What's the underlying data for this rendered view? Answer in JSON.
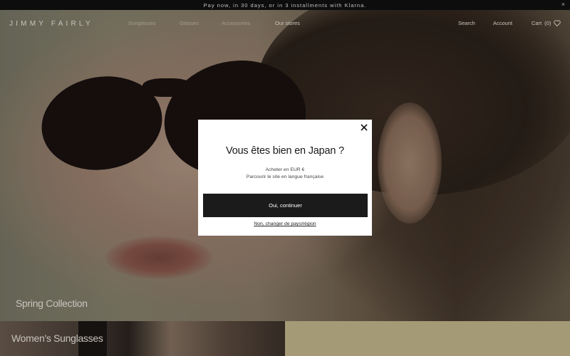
{
  "announcement": {
    "text": "Pay now, in 30 days, or in 3 installments with Klarna.",
    "close_icon": "close-icon"
  },
  "header": {
    "logo": "JIMMY FAIRLY",
    "nav": {
      "sunglasses": "Sunglasses",
      "glasses": "Glasses",
      "accessories": "Accessories",
      "stores": "Our stores"
    },
    "search": "Search",
    "account": "Account",
    "cart": "Cart",
    "cart_count": "(0)",
    "wishlist_icon": "heart-icon"
  },
  "hero": {
    "title": "Spring Collection"
  },
  "bottom": {
    "left_title": "Women's Sunglasses"
  },
  "modal": {
    "title": "Vous êtes bien en Japan ?",
    "line1": "Acheter en EUR €",
    "line2": "Parcourir le site en langue française",
    "confirm_label": "Oui, continuer",
    "change_label": "Non, changer de pays/région",
    "close_icon": "close-icon"
  },
  "colors": {
    "modal_button": "#1b1b1b",
    "announcement_bg": "#111111",
    "bottom_right_bg": "#c9bc8f"
  }
}
